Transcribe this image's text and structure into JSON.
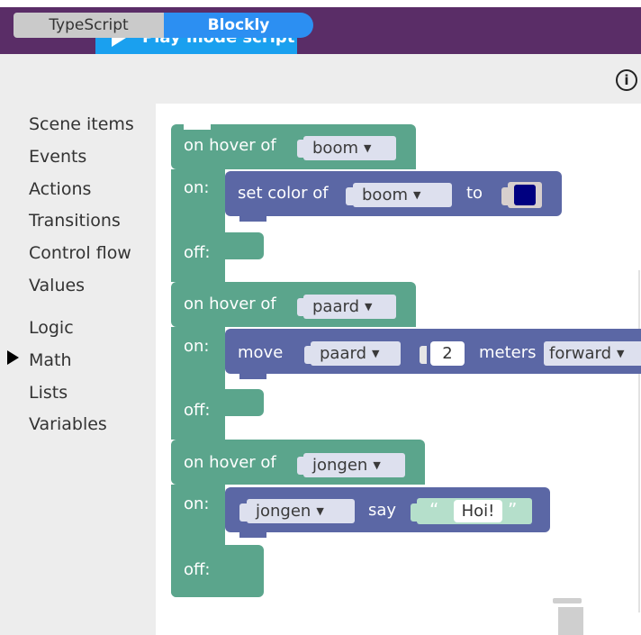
{
  "topbar": {
    "icons": [
      "gamepad-icon",
      "book-icon"
    ],
    "active_tab": "Play mode script",
    "color": "#5a2d67",
    "tab_color": "#1aa0ef"
  },
  "mode_switch": {
    "options": [
      "TypeScript",
      "Blockly"
    ],
    "selected": "Blockly"
  },
  "info_button": {
    "glyph": "i"
  },
  "toolbox": {
    "items": [
      "Scene items",
      "Events",
      "Actions",
      "Transitions",
      "Control flow",
      "Values",
      "Logic",
      "Math",
      "Lists",
      "Variables"
    ],
    "selected": "Control flow"
  },
  "blocks": [
    {
      "event": "on hover of",
      "target": "boom",
      "on_label": "on:",
      "off_label": "off:",
      "action": {
        "text": "set color of",
        "item": "boom",
        "to_label": "to",
        "color": "#000080"
      }
    },
    {
      "event": "on hover of",
      "target": "paard",
      "on_label": "on:",
      "off_label": "off:",
      "action": {
        "text": "move",
        "item": "paard",
        "amount": "2",
        "unit": "meters",
        "direction": "forward"
      }
    },
    {
      "event": "on hover of",
      "target": "jongen",
      "on_label": "on:",
      "off_label": "off:",
      "action": {
        "item": "jongen",
        "say_label": "say",
        "open_quote": "“",
        "text": "Hoi!",
        "close_quote": "”"
      }
    }
  ],
  "colors": {
    "event_block": "#5ba58c",
    "action_block": "#5b67a5",
    "dropdown_bg": "#dde0ee",
    "string_bg": "#b5dfcb"
  }
}
